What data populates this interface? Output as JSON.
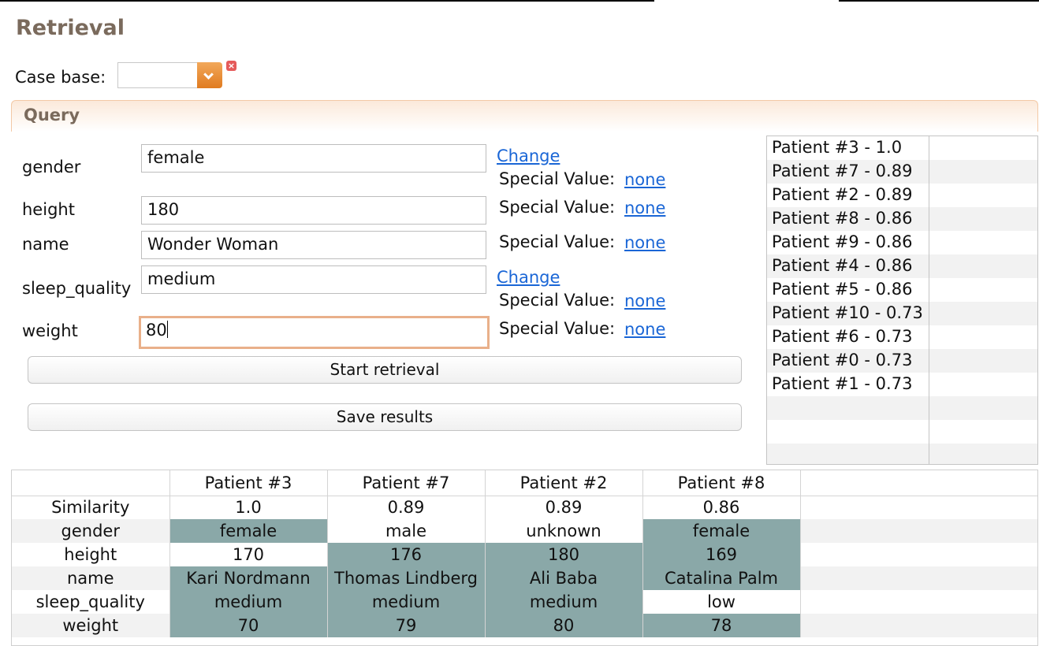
{
  "page": {
    "title": "Retrieval",
    "case_base_label": "Case base:",
    "case_base_value": "",
    "query_section_title": "Query"
  },
  "query": {
    "special_value_label": "Special Value:",
    "change_label": "Change",
    "fields": [
      {
        "name": "gender",
        "value": "female",
        "special": "none"
      },
      {
        "name": "height",
        "value": "180",
        "special": "none"
      },
      {
        "name": "name",
        "value": "Wonder Woman",
        "special": "none"
      },
      {
        "name": "sleep_quality",
        "value": "medium",
        "special": "none"
      },
      {
        "name": "weight",
        "value": "80",
        "special": "none"
      }
    ],
    "start_button": "Start retrieval",
    "save_button": "Save results"
  },
  "results_list": [
    "Patient #3 - 1.0",
    "Patient #7 - 0.89",
    "Patient #2 - 0.89",
    "Patient #8 - 0.86",
    "Patient #9 - 0.86",
    "Patient #4 - 0.86",
    "Patient #5 - 0.86",
    "Patient #10 - 0.73",
    "Patient #6 - 0.73",
    "Patient #0 - 0.73",
    "Patient #1 - 0.73"
  ],
  "comparison": {
    "columns": [
      "Patient #3",
      "Patient #7",
      "Patient #2",
      "Patient #8"
    ],
    "rows": [
      {
        "label": "Similarity",
        "values": [
          "1.0",
          "0.89",
          "0.89",
          "0.86"
        ]
      },
      {
        "label": "gender",
        "values": [
          "female",
          "male",
          "unknown",
          "female"
        ]
      },
      {
        "label": "height",
        "values": [
          "170",
          "176",
          "180",
          "169"
        ]
      },
      {
        "label": "name",
        "values": [
          "Kari Nordmann",
          "Thomas Lindberg",
          "Ali Baba",
          "Catalina Palm"
        ]
      },
      {
        "label": "sleep_quality",
        "values": [
          "medium",
          "medium",
          "medium",
          "low"
        ]
      },
      {
        "label": "weight",
        "values": [
          "70",
          "79",
          "80",
          "78"
        ]
      }
    ]
  },
  "colors": {
    "title": "#7a6a5c",
    "match_highlight": "#8aa8a8",
    "link": "#1a66d6",
    "accent_orange": "#e07b20"
  },
  "icons": {
    "dropdown": "chevron-down-icon",
    "clear": "close-icon"
  }
}
